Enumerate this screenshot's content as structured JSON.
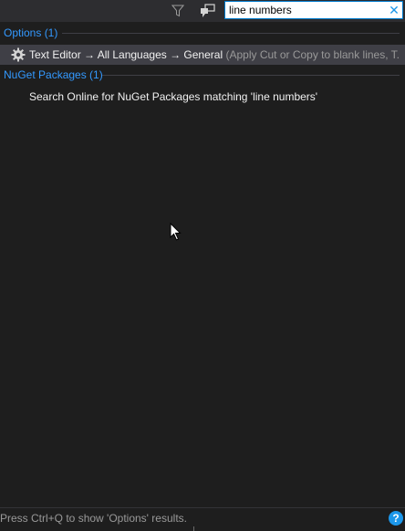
{
  "search": {
    "query": "line numbers",
    "clear_glyph": "✕"
  },
  "toolbar": {
    "filter_icon": "filter-icon",
    "scope_icon": "scope-icon"
  },
  "groups": {
    "options": {
      "label": "Options (1)",
      "results": [
        {
          "icon": "gear-icon",
          "title": "Text Editor → All Languages → General",
          "description": "(Apply Cut or Copy to blank lines, T..."
        }
      ]
    },
    "nuget": {
      "label": "NuGet Packages (1)",
      "results": [
        {
          "text": "Search Online for NuGet Packages matching 'line numbers'"
        }
      ]
    }
  },
  "status": {
    "text": "Press Ctrl+Q to show 'Options' results.",
    "help_glyph": "?"
  },
  "colors": {
    "background": "#1e1e1e",
    "accent": "#3399ff",
    "selection": "#3f3f46",
    "search_border": "#007acc"
  }
}
